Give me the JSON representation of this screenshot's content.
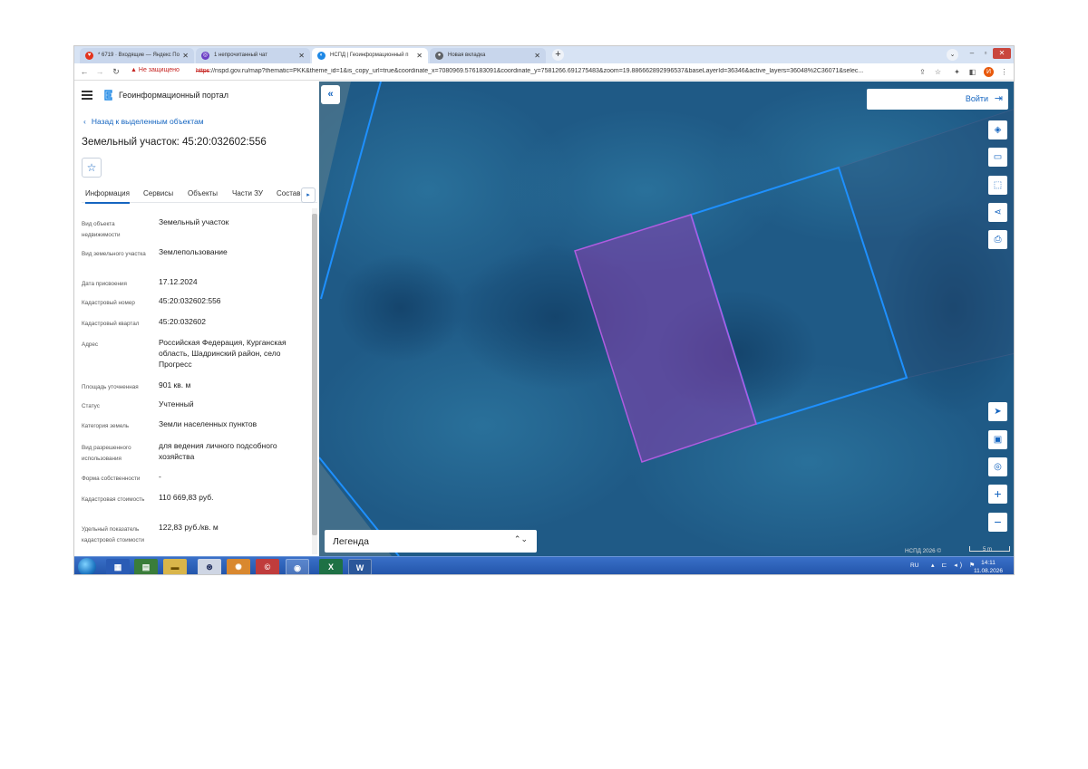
{
  "browser": {
    "tabs": [
      {
        "label": "* 6719 · Входящие — Яндекс По",
        "icon": "yandex-mail-icon"
      },
      {
        "label": "1 непрочитанный чат",
        "icon": "chat-icon"
      },
      {
        "label": "НСПД | Геоинформационный п",
        "icon": "nspd-icon"
      },
      {
        "label": "Новая вкладка",
        "icon": "chrome-icon"
      }
    ],
    "security_label": "Не защищено",
    "url_protocol": "https",
    "url_rest": "://nspd.gov.ru/map?thematic=PKK&theme_id=1&is_copy_url=true&coordinate_x=7080969.576183091&coordinate_y=7581266.691275483&zoom=19.886662892996537&baseLayerId=36346&active_layers=36048%2C36071&selec..."
  },
  "panel": {
    "portal_name": "Геоинформационный портал",
    "back_link": "Назад к выделенным объектам",
    "title": "Земельный участок: 45:20:032602:556",
    "tabs": [
      "Информация",
      "Сервисы",
      "Объекты",
      "Части ЗУ",
      "Состав"
    ],
    "properties": [
      {
        "key": "Вид объекта недвижимости",
        "value": "Земельный участок"
      },
      {
        "key": "Вид земельного участка",
        "value": "Землепользование"
      },
      {
        "key": "Дата присвоения",
        "value": "17.12.2024"
      },
      {
        "key": "Кадастровый номер",
        "value": "45:20:032602:556"
      },
      {
        "key": "Кадастровый квартал",
        "value": "45:20:032602"
      },
      {
        "key": "Адрес",
        "value": "Российская Федерация, Курганская область, Шадринский район, село Прогресс"
      },
      {
        "key": "Площадь уточненная",
        "value": "901 кв. м"
      },
      {
        "key": "Статус",
        "value": "Учтенный"
      },
      {
        "key": "Категория земель",
        "value": "Земли населенных пунктов"
      },
      {
        "key": "Вид разрешенного использования",
        "value": "для ведения личного подсобного хозяйства"
      },
      {
        "key": "Форма собственности",
        "value": "-"
      },
      {
        "key": "Кадастровая стоимость",
        "value": "110 669,83 руб."
      },
      {
        "key": "Удельный показатель кадастровой стоимости",
        "value": "122,83 руб./кв. м"
      }
    ]
  },
  "map": {
    "login_label": "Войти",
    "legend_label": "Легенда",
    "attribution": "НСПД 2026 ©",
    "scale_label": "5 m",
    "colors": {
      "parcel_border": "#1e90ff",
      "selected_fill": "#8a3fb0",
      "selected_border": "#b05ce0",
      "imagery_tint": "#1f5f8a"
    }
  },
  "taskbar": {
    "language": "RU",
    "time": "14:11",
    "date": "11.08.2026",
    "apps": [
      "explorer-icon",
      "media-icon",
      "paint-icon",
      "folder-icon",
      "app-icon",
      "turtle-icon",
      "ccleaner-icon",
      "chrome-icon",
      "excel-icon",
      "word-icon"
    ],
    "excel_glyph": "X",
    "word_glyph": "W"
  }
}
